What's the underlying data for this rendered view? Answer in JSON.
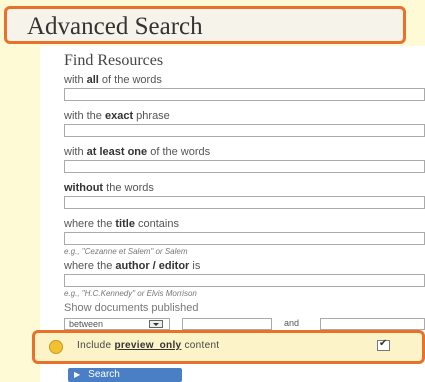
{
  "header": {
    "title": "Advanced Search"
  },
  "section": {
    "title": "Find Resources"
  },
  "fields": [
    {
      "label_prefix": "with ",
      "label_emph": "all",
      "label_suffix": " of the words"
    },
    {
      "label_prefix": "with the ",
      "label_emph": "exact",
      "label_suffix": " phrase"
    },
    {
      "label_prefix": "with ",
      "label_emph": "at least one",
      "label_suffix": " of the words"
    },
    {
      "label_prefix": "",
      "label_emph": "without",
      "label_suffix": " the words"
    },
    {
      "label_prefix": "where the ",
      "label_emph": "title",
      "label_suffix": " contains",
      "hint": "e.g., \"Cezanne et Salem\" or Salem"
    },
    {
      "label_prefix": "where the ",
      "label_emph": "author / editor",
      "label_suffix": " is",
      "hint": "e.g., \"H.C.Kennedy\" or Elvis Morrison"
    }
  ],
  "published": {
    "label": "Show documents published",
    "select_value": "between",
    "and_text": "and"
  },
  "preview": {
    "label_prefix": "Include ",
    "label_emph": "preview_only",
    "label_suffix": " content",
    "checked": true
  },
  "search_button": {
    "label": "Search"
  },
  "colors": {
    "highlight": "#e8722c",
    "button": "#4a7fc6",
    "background": "#fefad6"
  }
}
